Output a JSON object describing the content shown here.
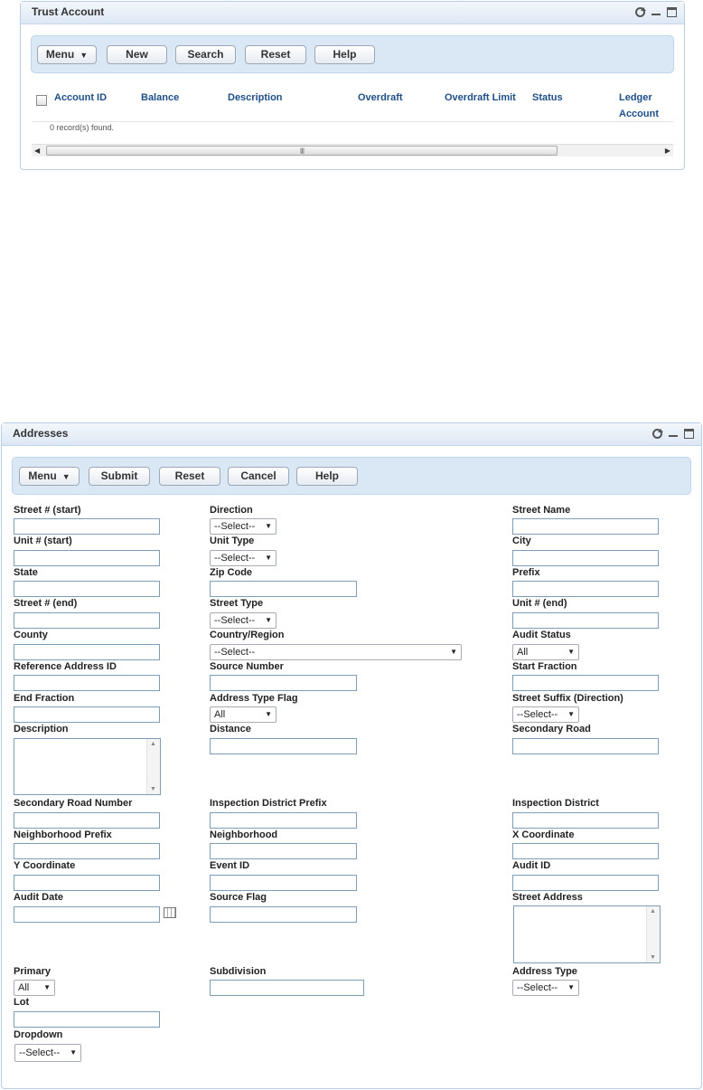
{
  "trust": {
    "title": "Trust Account",
    "toolbar": {
      "menu": "Menu",
      "new": "New",
      "search": "Search",
      "reset": "Reset",
      "help": "Help"
    },
    "columns": [
      "Account ID",
      "Balance",
      "Description",
      "Overdraft",
      "Overdraft Limit",
      "Status",
      "Ledger",
      "Account"
    ],
    "records_text": "0 record(s) found.",
    "scroll_grip": "III"
  },
  "addresses": {
    "title": "Addresses",
    "toolbar": {
      "menu": "Menu",
      "submit": "Submit",
      "reset": "Reset",
      "cancel": "Cancel",
      "help": "Help"
    },
    "labels": {
      "street_start": "Street # (start)",
      "direction": "Direction",
      "street_name": "Street Name",
      "unit_start": "Unit # (start)",
      "unit_type": "Unit Type",
      "city": "City",
      "state": "State",
      "zip": "Zip Code",
      "prefix": "Prefix",
      "street_end": "Street # (end)",
      "street_type": "Street Type",
      "unit_end": "Unit # (end)",
      "county": "County",
      "country": "Country/Region",
      "audit_status": "Audit Status",
      "ref_addr": "Reference Address ID",
      "source_number": "Source Number",
      "start_fraction": "Start Fraction",
      "end_fraction": "End Fraction",
      "addr_type_flag": "Address Type Flag",
      "street_suffix": "Street Suffix (Direction)",
      "description": "Description",
      "distance": "Distance",
      "secondary_road": "Secondary Road",
      "sec_road_num": "Secondary Road Number",
      "insp_district_prefix": "Inspection District Prefix",
      "insp_district": "Inspection District",
      "neigh_prefix": "Neighborhood Prefix",
      "neighborhood": "Neighborhood",
      "x_coord": "X Coordinate",
      "y_coord": "Y Coordinate",
      "event_id": "Event ID",
      "audit_id": "Audit ID",
      "audit_date": "Audit Date",
      "source_flag": "Source Flag",
      "street_address": "Street Address",
      "primary": "Primary",
      "subdivision": "Subdivision",
      "address_type": "Address Type",
      "lot": "Lot",
      "dropdown": "Dropdown"
    },
    "selects": {
      "direction": "--Select--",
      "unit_type": "--Select--",
      "street_type": "--Select--",
      "country": "--Select--",
      "audit_status": "All",
      "addr_type_flag": "All",
      "street_suffix": "--Select--",
      "primary": "All",
      "address_type": "--Select--",
      "dropdown": "--Select--"
    }
  }
}
